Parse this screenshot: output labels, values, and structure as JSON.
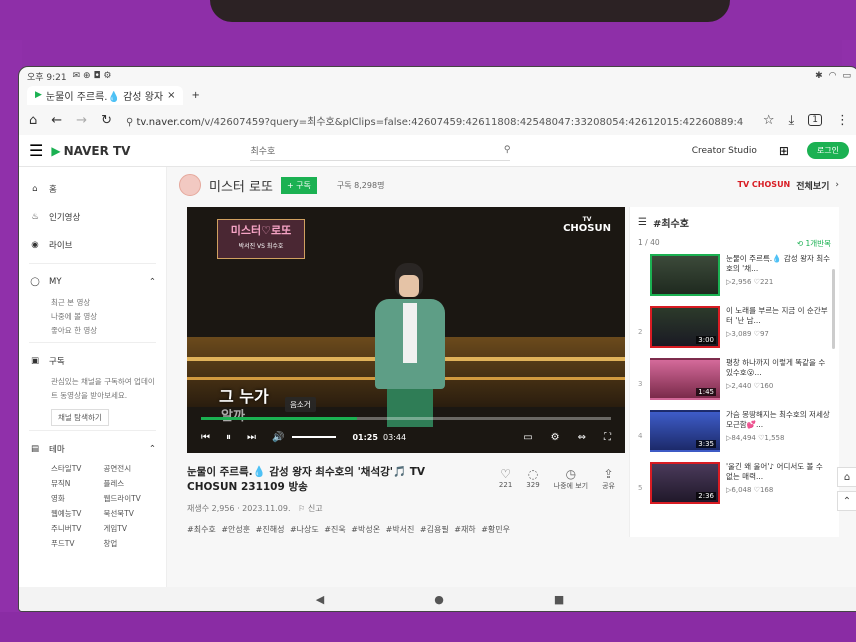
{
  "status": {
    "time": "오후 9:21"
  },
  "browser": {
    "tab_title": "눈물이 주르륵.💧 감성 왕자",
    "tab_close": "×",
    "new_tab": "+",
    "url_host": "tv.naver.com",
    "url_path": "/v/42607459?query=최수호&plClips=false:42607459:42611808:42548047:33208054:42612015:42260889:4",
    "tab_count": "1"
  },
  "header": {
    "logo": "NAVER TV",
    "search_value": "최수호",
    "creator_studio": "Creator Studio",
    "login": "로그인"
  },
  "sidebar": {
    "home": "홈",
    "popular": "인기영상",
    "live": "라이브",
    "my": "MY",
    "my_items": [
      "최근 본 영상",
      "나중에 볼 영상",
      "좋아요 한 영상"
    ],
    "subscribe": "구독",
    "subscribe_desc": "관심있는 채널을 구독하여 업데이트 동영상을 받아보세요.",
    "find_channel": "채널 탐색하기",
    "theme": "테마",
    "themes": [
      "스타일TV",
      "공연전시",
      "뮤직N",
      "플레스",
      "영화",
      "웹드라이TV",
      "웹예능TV",
      "북선북TV",
      "주니버TV",
      "게임TV",
      "푸드TV",
      "창업"
    ]
  },
  "channel": {
    "name": "미스터 로또",
    "subscribe": "+ 구독",
    "subscribers": "구독 8,298명",
    "tvchosun_badge": "TV CHOSUN",
    "view_all": "전체보기"
  },
  "player": {
    "overlay_title": "미스터♡로또",
    "overlay_names": "박서진 VS 최수호",
    "watermark_small": "TV",
    "watermark": "CHOSUN",
    "caption_line1": "그 누가",
    "caption_line2": "알까",
    "tooltip": "음소거",
    "current_time": "01:25",
    "duration": "03:44",
    "progress": 0.38,
    "volume": 1.0
  },
  "video": {
    "title": "눈물이 주르륵.💧 감성 왕자 최수호의 '채석강'🎵 TV CHOSUN 231109 방송",
    "likes": "221",
    "comments": "329",
    "later": "나중에 보기",
    "share": "공유",
    "meta": "재생수 2,956 · 2023.11.09.",
    "report": "신고",
    "tags": "#최수호 #안성훈 #진해성 #나상도 #진욱 #박성온 #박서진 #김용필 #재하 #황민우"
  },
  "playlist": {
    "title": "#최수호",
    "counter": "1 / 40",
    "repeat": "1개반복",
    "items": [
      {
        "num": "",
        "title": "눈물이 주르륵.💧 감성 왕자 최수호의 '채...",
        "views": "2,956",
        "likes": "221",
        "duration": ""
      },
      {
        "num": "2",
        "title": "이 노래를 부르는 지금 이 순간부터 '난 남...",
        "views": "3,089",
        "likes": "97",
        "duration": "3:00"
      },
      {
        "num": "3",
        "title": "평창 하나까지 이렇게 똑같을 수 있수호😮...",
        "views": "2,440",
        "likes": "160",
        "duration": "1:45"
      },
      {
        "num": "4",
        "title": "가슴 몽땅해지는 최수호의 저세상 모근함💕...",
        "views": "84,494",
        "likes": "1,558",
        "duration": "3:35"
      },
      {
        "num": "5",
        "title": "'울긴 왜 울어'♪ 어디서도 볼 수 없는 매력...",
        "views": "6,048",
        "likes": "168",
        "duration": "2:36"
      }
    ]
  }
}
